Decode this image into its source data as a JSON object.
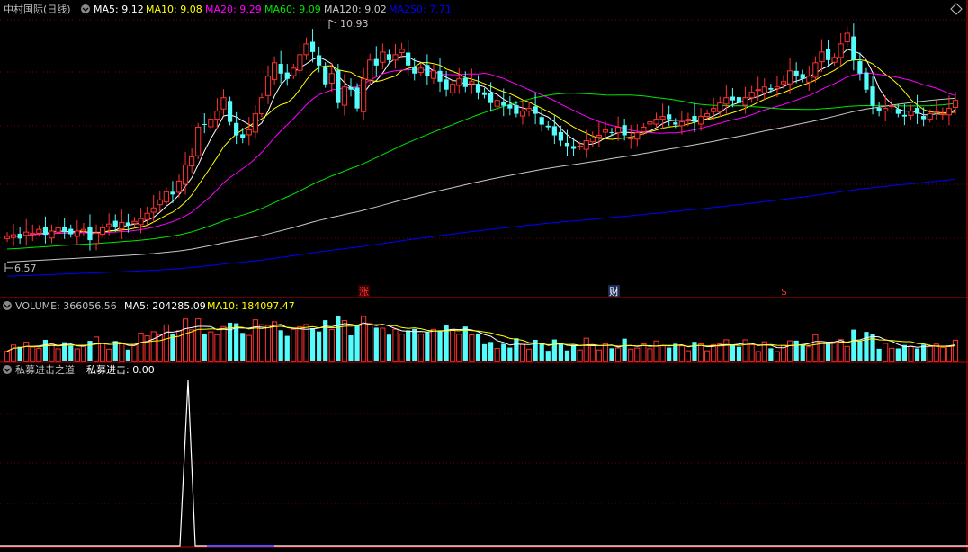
{
  "colors": {
    "background": "#000000",
    "grid": "#7a0000",
    "separator": "#c00000",
    "up": "#ff3232",
    "down": "#54fcfc",
    "ma5": "#ffffff",
    "ma10": "#ffff00",
    "ma20": "#ff00ff",
    "ma60": "#00e600",
    "ma120": "#c8c8c8",
    "ma250": "#0000ff",
    "label": "#c0c0c0"
  },
  "main_panel": {
    "title": "中村国际(日线)",
    "indicators": [
      {
        "name": "MA5",
        "text": "MA5: 9.12",
        "color": "#ffffff"
      },
      {
        "name": "MA10",
        "text": "MA10: 9.08",
        "color": "#ffff00"
      },
      {
        "name": "MA20",
        "text": "MA20: 9.29",
        "color": "#ff00ff"
      },
      {
        "name": "MA60",
        "text": "MA60: 9.09",
        "color": "#00e600"
      },
      {
        "name": "MA120",
        "text": "MA120: 9.02",
        "color": "#c8c8c8"
      },
      {
        "name": "MA250",
        "text": "MA250: 7.71",
        "color": "#0000ff"
      }
    ],
    "high_marker": "10.93",
    "low_marker": "6.57",
    "event_markers": [
      {
        "text": "涨",
        "color": "#ff3232",
        "bg": "#3a0000"
      },
      {
        "text": "财",
        "color": "#ffffff",
        "bg": "#1a2a55"
      },
      {
        "text": "$",
        "color": "#ff3232",
        "bg": "#000000"
      }
    ]
  },
  "volume_panel": {
    "title": "VOLUME: 366056.56",
    "ma5": "MA5: 204285.09",
    "ma10": "MA10: 184097.47"
  },
  "indicator_panel": {
    "title": "私募进击之道",
    "value": "私募进击: 0.00"
  },
  "chart_data": {
    "type": "candlestick",
    "price_range": [
      6.57,
      10.93
    ],
    "days": 150,
    "close": [
      7.02,
      7.05,
      6.98,
      7.1,
      7.08,
      7.15,
      7.05,
      7.12,
      7.18,
      7.1,
      7.06,
      7.12,
      7.15,
      6.95,
      7.08,
      7.18,
      7.25,
      7.2,
      7.28,
      7.22,
      7.3,
      7.35,
      7.45,
      7.55,
      7.7,
      7.85,
      7.8,
      8.05,
      8.35,
      8.5,
      9.05,
      9.1,
      9.2,
      9.35,
      9.6,
      9.15,
      8.9,
      8.85,
      9.0,
      9.3,
      9.6,
      10.0,
      10.25,
      10.05,
      9.95,
      10.15,
      10.4,
      10.6,
      10.45,
      10.2,
      9.85,
      10.05,
      9.5,
      9.8,
      9.75,
      9.4,
      9.95,
      10.3,
      10.2,
      10.45,
      10.3,
      10.4,
      10.5,
      10.2,
      10.05,
      10.15,
      10.0,
      10.1,
      9.9,
      9.75,
      9.85,
      9.95,
      9.8,
      9.9,
      9.7,
      9.65,
      9.5,
      9.55,
      9.45,
      9.4,
      9.3,
      9.35,
      9.4,
      9.3,
      9.1,
      9.05,
      8.9,
      8.8,
      8.7,
      8.65,
      8.7,
      8.8,
      8.85,
      8.9,
      9.0,
      8.95,
      9.05,
      8.9,
      8.85,
      8.95,
      9.05,
      9.15,
      9.2,
      9.25,
      9.2,
      9.1,
      9.15,
      9.2,
      9.15,
      9.25,
      9.3,
      9.4,
      9.5,
      9.6,
      9.55,
      9.5,
      9.6,
      9.7,
      9.75,
      9.8,
      9.75,
      9.8,
      9.9,
      10.1,
      10.0,
      9.95,
      10.0,
      10.25,
      10.45,
      10.3,
      10.35,
      10.6,
      10.8,
      10.3,
      10.05,
      9.75,
      9.45,
      9.35,
      9.4,
      9.45,
      9.3,
      9.25,
      9.35,
      9.3,
      9.2,
      9.3,
      9.35,
      9.3,
      9.4,
      9.55
    ]
  }
}
